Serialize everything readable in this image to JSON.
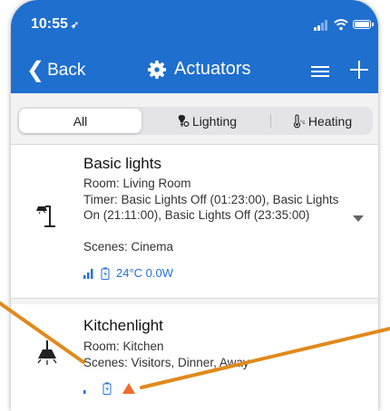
{
  "status_bar": {
    "time": "10:55",
    "location_arrow": "➶"
  },
  "nav": {
    "back_label": "Back",
    "title": "Actuators"
  },
  "filter": {
    "options": [
      {
        "label": "All"
      },
      {
        "label": "Lighting"
      },
      {
        "label": "Heating"
      }
    ],
    "selected": "All"
  },
  "devices": [
    {
      "name": "Basic lights",
      "room": "Room: Living Room",
      "timer": "Timer: Basic Lights Off (01:23:00), Basic Lights On (21:11:00), Basic Lights Off (23:35:00)",
      "scenes": "Scenes: Cinema",
      "status_text": "24°C 0.0W",
      "icon": "desk-lamp-icon"
    },
    {
      "name": "Kitchenlight",
      "room": "Room: Kitchen",
      "scenes": "Scenes: Visitors, Dinner, Away",
      "icon": "pendant-lamp-icon",
      "warning": true
    }
  ],
  "colors": {
    "header": "#1f6fcf",
    "accent": "#2372d6",
    "warning": "#ee6c2b",
    "annotation": "#e08a1c"
  }
}
